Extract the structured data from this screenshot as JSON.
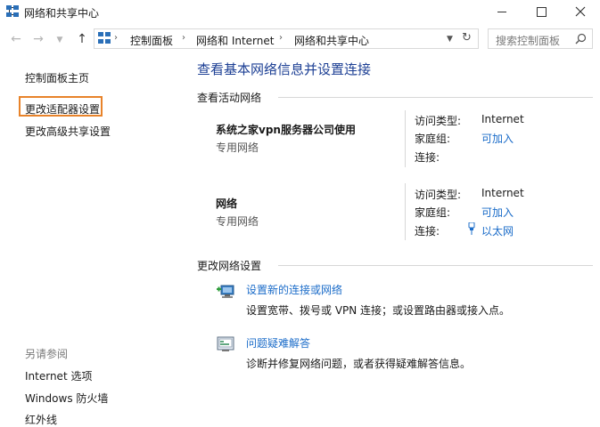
{
  "window": {
    "title": "网络和共享中心"
  },
  "address": {
    "crumbs": [
      "控制面板",
      "网络和 Internet",
      "网络和共享中心"
    ],
    "search_placeholder": "搜索控制面板"
  },
  "sidebar": {
    "home": "控制面板主页",
    "items": [
      "更改适配器设置",
      "更改高级共享设置"
    ],
    "see_also_title": "另请参阅",
    "see_also": [
      "Internet 选项",
      "Windows 防火墙",
      "红外线"
    ]
  },
  "main": {
    "title": "查看基本网络信息并设置连接",
    "active_section": "查看活动网络",
    "networks": [
      {
        "name": "系统之家vpn服务器公司使用",
        "type": "专用网络",
        "access_label": "访问类型:",
        "access_value": "Internet",
        "homegroup_label": "家庭组:",
        "homegroup_value": "可加入",
        "connection_label": "连接:",
        "connection_value": ""
      },
      {
        "name": "网络",
        "type": "专用网络",
        "access_label": "访问类型:",
        "access_value": "Internet",
        "homegroup_label": "家庭组:",
        "homegroup_value": "可加入",
        "connection_label": "连接:",
        "connection_value": "以太网"
      }
    ],
    "change_section": "更改网络设置",
    "tasks": [
      {
        "link": "设置新的连接或网络",
        "desc": "设置宽带、拨号或 VPN 连接；或设置路由器或接入点。",
        "icon": "new-connection-icon"
      },
      {
        "link": "问题疑难解答",
        "desc": "诊断并修复网络问题，或者获得疑难解答信息。",
        "icon": "troubleshoot-icon"
      }
    ]
  },
  "colors": {
    "link": "#1b6cc9",
    "title": "#1c3f94",
    "highlight_box": "#e8832a"
  }
}
